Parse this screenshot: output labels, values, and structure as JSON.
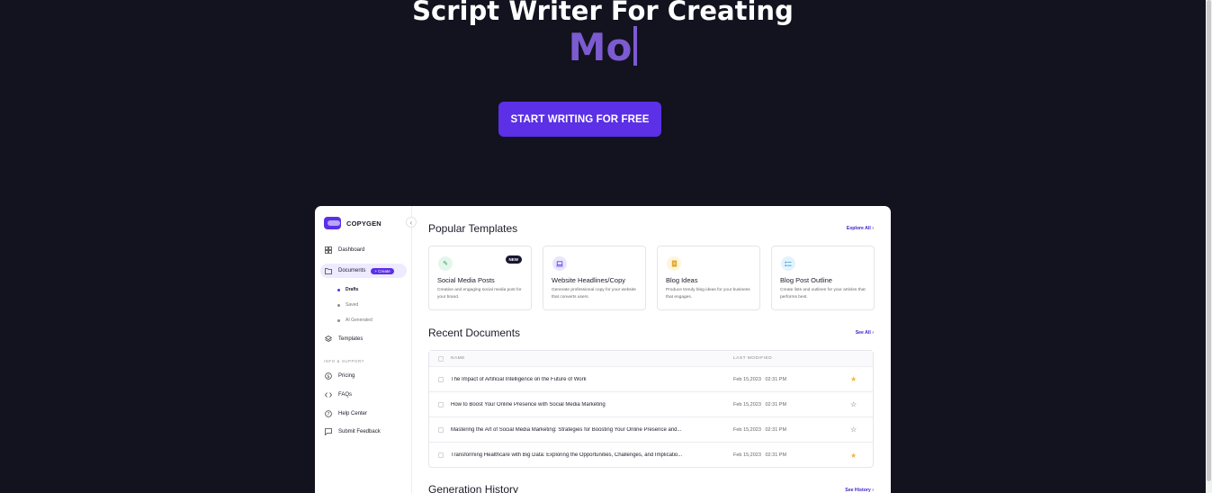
{
  "hero": {
    "title": "Script Writer For Creating",
    "typed_text": "Mo",
    "cta_label": "START WRITING FOR FREE"
  },
  "app": {
    "logo_text": "COPYGEN",
    "sidebar": {
      "items": [
        {
          "label": "Dashboard",
          "icon": "grid-icon"
        },
        {
          "label": "Documents",
          "icon": "folder-icon",
          "badge": "+ Create"
        },
        {
          "label": "Templates",
          "icon": "layers-icon"
        }
      ],
      "sub_items": [
        {
          "label": "Drafts"
        },
        {
          "label": "Saved"
        },
        {
          "label": "AI Generated"
        }
      ],
      "section_label": "INFO & SUPPORT",
      "support_items": [
        {
          "label": "Pricing",
          "icon": "dollar-icon"
        },
        {
          "label": "FAQs",
          "icon": "code-icon"
        },
        {
          "label": "Help Center",
          "icon": "help-icon"
        },
        {
          "label": "Submit Feedback",
          "icon": "message-icon"
        }
      ]
    },
    "popular": {
      "title": "Popular Templates",
      "link": "Explore All",
      "cards": [
        {
          "title": "Social Media Posts",
          "desc": "Creative and engaging social media post for your brand.",
          "badge": "NEW",
          "icon": "pencil-icon",
          "icon_bg": "#e4f6ec",
          "icon_color": "#2e9d5a"
        },
        {
          "title": "Website Headlines/Copy",
          "desc": "Generate professional copy for your website that converts users.",
          "icon": "laptop-icon",
          "icon_bg": "#e9e6fb",
          "icon_color": "#5b30e6"
        },
        {
          "title": "Blog Ideas",
          "desc": "Produce trendy blog ideas for your business that engages.",
          "icon": "document-icon",
          "icon_bg": "#fdf5dd",
          "icon_color": "#e1a826"
        },
        {
          "title": "Blog Post Outline",
          "desc": "Create lists and outlines for your articles that performs best.",
          "icon": "list-icon",
          "icon_bg": "#e3f3fb",
          "icon_color": "#2e9ad6"
        }
      ]
    },
    "recent": {
      "title": "Recent Documents",
      "link": "See All",
      "columns": [
        "NAME",
        "LAST MODIFIED"
      ],
      "rows": [
        {
          "name": "The Impact of Artificial Intelligence on the Future of Work",
          "date": "Feb 15,2023",
          "time": "02:31 PM",
          "starred": true
        },
        {
          "name": "How to Boost Your Online Presence with Social Media Marketing",
          "date": "Feb 15,2023",
          "time": "02:31 PM",
          "starred": false
        },
        {
          "name": "Mastering the Art of Social Media Marketing: Strategies for Boosting Your Online Presence and...",
          "date": "Feb 15,2023",
          "time": "02:31 PM",
          "starred": false
        },
        {
          "name": "Transforming Healthcare with Big Data: Exploring the Opportunities, Challenges, and Implicatio...",
          "date": "Feb 15,2023",
          "time": "02:31 PM",
          "starred": true
        }
      ]
    },
    "history": {
      "title": "Generation History",
      "link": "See History"
    }
  },
  "colors": {
    "background": "#13121f",
    "accent": "#5b30e6",
    "typed": "#7c5bd1",
    "star": "#f4b43e"
  }
}
